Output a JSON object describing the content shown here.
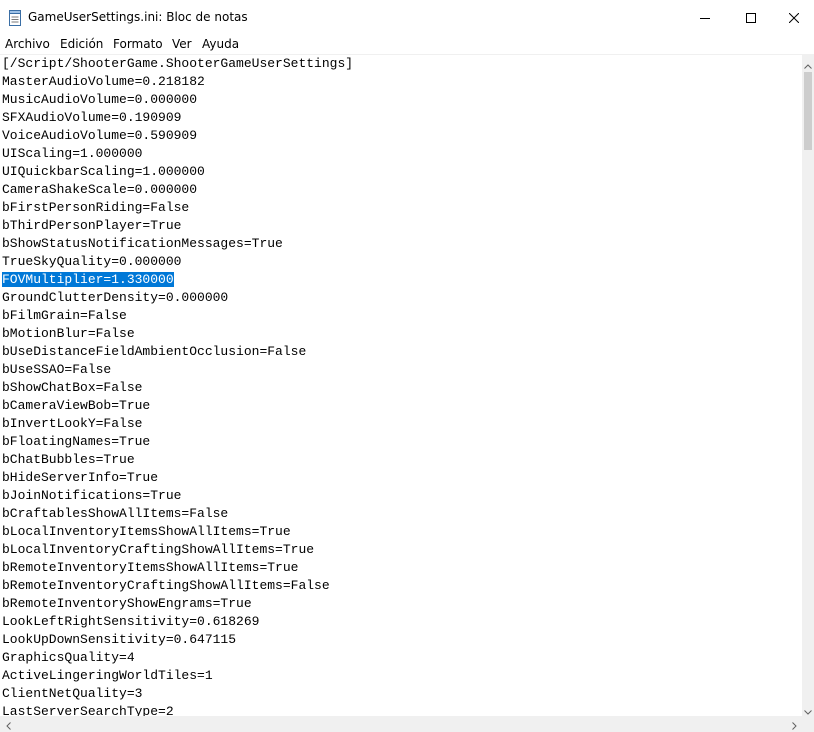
{
  "window": {
    "title": "GameUserSettings.ini: Bloc de notas"
  },
  "menu": {
    "items": [
      "Archivo",
      "Edición",
      "Formato",
      "Ver",
      "Ayuda"
    ]
  },
  "document": {
    "selected_line_index": 12,
    "lines": [
      "[/Script/ShooterGame.ShooterGameUserSettings]",
      "MasterAudioVolume=0.218182",
      "MusicAudioVolume=0.000000",
      "SFXAudioVolume=0.190909",
      "VoiceAudioVolume=0.590909",
      "UIScaling=1.000000",
      "UIQuickbarScaling=1.000000",
      "CameraShakeScale=0.000000",
      "bFirstPersonRiding=False",
      "bThirdPersonPlayer=True",
      "bShowStatusNotificationMessages=True",
      "TrueSkyQuality=0.000000",
      "FOVMultiplier=1.330000",
      "GroundClutterDensity=0.000000",
      "bFilmGrain=False",
      "bMotionBlur=False",
      "bUseDistanceFieldAmbientOcclusion=False",
      "bUseSSAO=False",
      "bShowChatBox=False",
      "bCameraViewBob=True",
      "bInvertLookY=False",
      "bFloatingNames=True",
      "bChatBubbles=True",
      "bHideServerInfo=True",
      "bJoinNotifications=True",
      "bCraftablesShowAllItems=False",
      "bLocalInventoryItemsShowAllItems=True",
      "bLocalInventoryCraftingShowAllItems=True",
      "bRemoteInventoryItemsShowAllItems=True",
      "bRemoteInventoryCraftingShowAllItems=False",
      "bRemoteInventoryShowEngrams=True",
      "LookLeftRightSensitivity=0.618269",
      "LookUpDownSensitivity=0.647115",
      "GraphicsQuality=4",
      "ActiveLingeringWorldTiles=1",
      "ClientNetQuality=3",
      "LastServerSearchType=2"
    ]
  },
  "colors": {
    "selection": "#0078d7",
    "scrollbar_track": "#f0f0f0",
    "scrollbar_thumb": "#cdcdcd"
  },
  "icons": {
    "title": "notepad-icon",
    "minimize": "minimize-icon",
    "maximize": "maximize-icon",
    "close": "close-icon"
  }
}
